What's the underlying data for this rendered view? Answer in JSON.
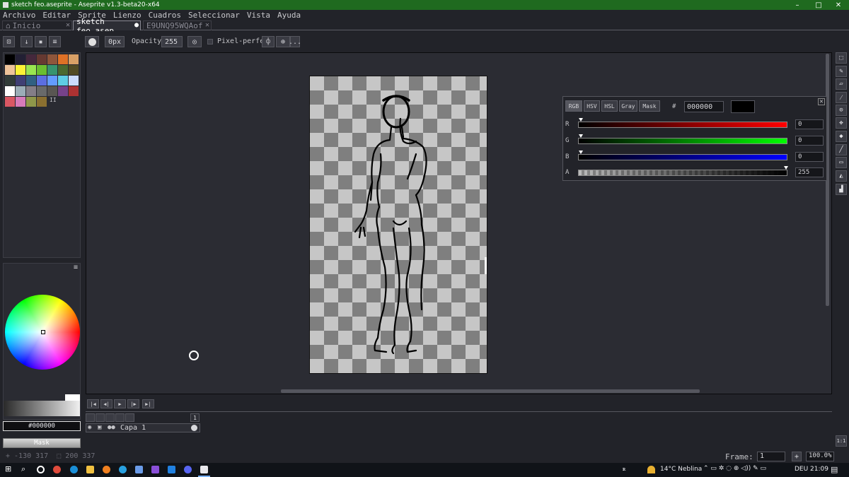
{
  "window": {
    "title": "sketch feo.aseprite - Aseprite v1.3-beta20-x64",
    "minimize": "–",
    "maximize": "□",
    "close": "✕"
  },
  "menu": [
    "Archivo",
    "Editar",
    "Sprite",
    "Lienzo",
    "Cuadros",
    "Seleccionar",
    "Vista",
    "Ayuda"
  ],
  "tabs": [
    {
      "label": "Inicio",
      "close": "✕"
    },
    {
      "label": "sketch feo.asep",
      "close": "●"
    },
    {
      "label": "E9UNQ95WQAof",
      "close": "✕"
    }
  ],
  "toolbar": {
    "brush_size": "0px",
    "opacity_label": "Opacity:",
    "opacity_value": "255",
    "pixel_perfect_label": "Pixel-perfect",
    "more_label": "..."
  },
  "palette": {
    "menu_icon": "≡",
    "menu_marker": "II",
    "colors": [
      "#000000",
      "#222034",
      "#45283c",
      "#663931",
      "#8f563b",
      "#df7126",
      "#d9a066",
      "#eec39a",
      "#fbf236",
      "#99e550",
      "#6abe30",
      "#37946e",
      "#4b692f",
      "#524b24",
      "#323c39",
      "#3f3f74",
      "#306082",
      "#5b6ee1",
      "#639bff",
      "#5fcde4",
      "#cbdbfc",
      "#ffffff",
      "#9badb7",
      "#847e87",
      "#696a6a",
      "#595652",
      "#76428a",
      "#ac3232",
      "#d95763",
      "#d77bba",
      "#8f974a",
      "#8a6f30"
    ]
  },
  "color_panel": {
    "menu_icon": "≡",
    "hex": "#000000",
    "mask_label": "Mask"
  },
  "color_popup": {
    "modes": [
      "RGB",
      "HSV",
      "HSL",
      "Gray",
      "Mask"
    ],
    "hash": "#",
    "hex_value": "000000",
    "close": "✕",
    "channels": [
      {
        "label": "R",
        "value": "0",
        "color": "#ff0000"
      },
      {
        "label": "G",
        "value": "0",
        "color": "#00ff00"
      },
      {
        "label": "B",
        "value": "0",
        "color": "#0000ff"
      },
      {
        "label": "A",
        "value": "255",
        "color": "#000000"
      }
    ]
  },
  "timeline": {
    "buttons": [
      "|◀",
      "◀|",
      "▶",
      "|▶",
      "▶|"
    ],
    "layer_name": "Capa 1",
    "frame_number": "1"
  },
  "status": {
    "cursor_coords": "+ -130 317",
    "selection_size": "⬚ 200 337",
    "frame_label": "Frame:",
    "frame_value": "1",
    "zoom_plus": "+",
    "zoom_value": "100.0%"
  },
  "taskbar": {
    "weather": "14°C  Neblina",
    "language": "DEU",
    "time": "21:09",
    "notification": "▤"
  }
}
